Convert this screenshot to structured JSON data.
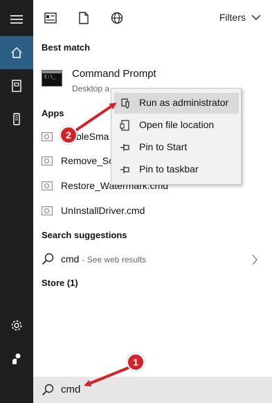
{
  "toolbar": {
    "filters_label": "Filters"
  },
  "sections": {
    "best_match": "Best match",
    "apps": "Apps",
    "search_suggestions": "Search suggestions",
    "store": "Store (1)"
  },
  "best_match": {
    "title": "Command Prompt",
    "subtitle": "Desktop a"
  },
  "apps": [
    {
      "label": "bleSma"
    },
    {
      "label": "Remove_Sc"
    },
    {
      "label": "Restore_Watermark.cmd"
    },
    {
      "label": "UnInstallDriver.cmd"
    }
  ],
  "context_menu": [
    {
      "label": "Run as administrator",
      "icon": "shield-icon",
      "highlighted": true
    },
    {
      "label": "Open file location",
      "icon": "folder-file-icon"
    },
    {
      "label": "Pin to Start",
      "icon": "pin-icon"
    },
    {
      "label": "Pin to taskbar",
      "icon": "pin-icon"
    }
  ],
  "suggestion": {
    "query": "cmd",
    "hint": "- See web results"
  },
  "search": {
    "value": "cmd"
  },
  "annotations": {
    "badge1": "1",
    "badge2": "2",
    "color": "#d2232a"
  },
  "colors": {
    "rail": "#1f1f1f",
    "rail_active": "#2b5f86",
    "menu_highlight": "#dadada"
  }
}
